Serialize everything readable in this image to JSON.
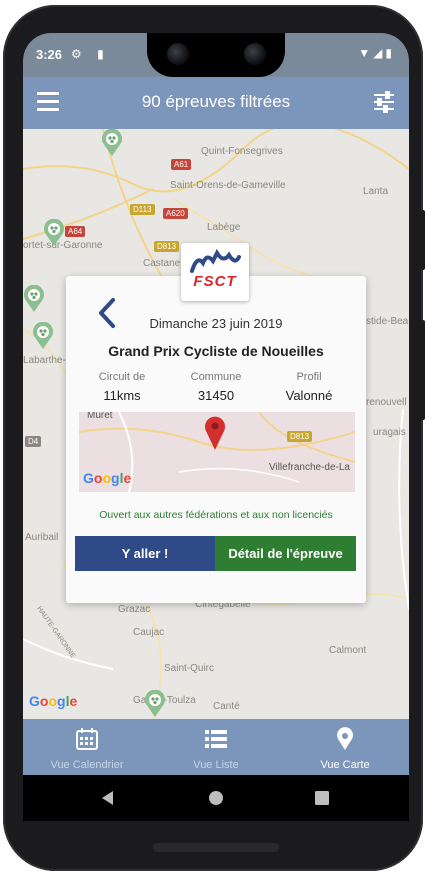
{
  "status": {
    "time": "3:26"
  },
  "appbar": {
    "title": "90 épreuves filtrées"
  },
  "map": {
    "places": [
      "Quint-Fonsegrives",
      "Saint-Orens-de-Gameville",
      "Lanta",
      "Labège",
      "Castane",
      "ortet-sur-Garonne",
      "Labarthe-",
      "stide-Bea",
      "renouvell",
      "uragais",
      "Auribail",
      "Grazac",
      "Cintegabelle",
      "Caujac",
      "Calmont",
      "Saint-Quirc",
      "Gaillac-Toulza",
      "Canté",
      "HAUTE-GARONNE"
    ],
    "roads": [
      "A61",
      "D113",
      "A620",
      "A64",
      "D813",
      "D4"
    ],
    "attribution": "Google"
  },
  "card": {
    "logo_text": "FSCT",
    "date": "Dimanche 23 juin 2019",
    "title": "Grand Prix Cycliste de Noueilles",
    "circuit": {
      "label": "Circuit de",
      "value": "11kms"
    },
    "commune": {
      "label": "Commune",
      "value": "31450"
    },
    "profil": {
      "label": "Profil",
      "value": "Valonné"
    },
    "minimap": {
      "place_a": "Muret",
      "place_b": "Villefranche-de-La",
      "road": "D813",
      "attribution": "Google"
    },
    "note": "Ouvert aux autres fédérations et aux non licenciés",
    "btn_go": "Y aller !",
    "btn_detail": "Détail de l'épreuve"
  },
  "bottomnav": {
    "items": [
      {
        "label": "Vue Calendrier",
        "icon": "calendar-icon"
      },
      {
        "label": "Vue Liste",
        "icon": "list-icon"
      },
      {
        "label": "Vue Carte",
        "icon": "map-pin-icon"
      }
    ],
    "active": "Vue Carte"
  },
  "colors": {
    "primary": "#7c96bb",
    "go": "#2e4a87",
    "detail": "#2f7d32",
    "pin": "#8cbf8f",
    "marker": "#d32f2f"
  }
}
